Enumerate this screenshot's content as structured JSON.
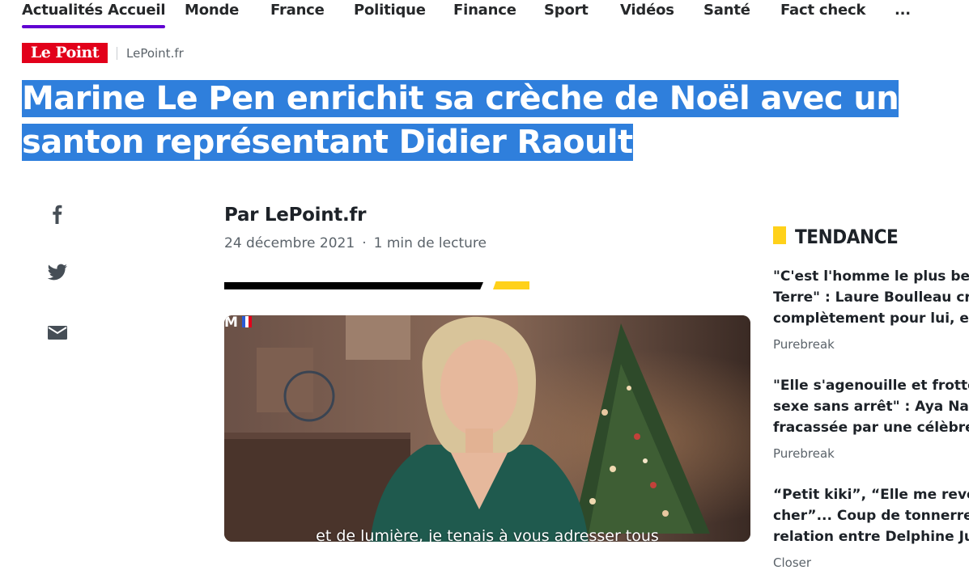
{
  "nav": {
    "items": [
      "Actualités Accueil",
      "Monde",
      "France",
      "Politique",
      "Finance",
      "Sport",
      "Vidéos",
      "Santé",
      "Fact check",
      "..."
    ],
    "active_index": 0,
    "accent_color": "#6001d2"
  },
  "source": {
    "logo_text": "Le Point",
    "name": "LePoint.fr",
    "logo_color": "#e2001a"
  },
  "article": {
    "headline": "Marine Le Pen enrichit sa crèche de Noël avec un santon représentant Didier Raoult",
    "headline_selected": true,
    "selection_color": "#2f7fdc",
    "byline": "Par LePoint.fr",
    "date": "24 décembre 2021",
    "separator": "·",
    "read_time": "1 min de lecture",
    "video": {
      "subtitle": "et de lumière, je tenais à vous adresser tous",
      "logo_icon": "m6-logo-icon"
    }
  },
  "share": [
    {
      "icon": "facebook-icon"
    },
    {
      "icon": "twitter-icon"
    },
    {
      "icon": "mail-icon"
    }
  ],
  "trending": {
    "title": "TENDANCE",
    "accent_color": "#ffd11a",
    "items": [
      {
        "lines": [
          "\"C'est l'homme le plus beau",
          "Terre\" : Laure Boulleau crac",
          "complètement pour lui, et v"
        ],
        "source": "Purebreak"
      },
      {
        "lines": [
          "\"Elle s'agenouille et frotte s",
          "sexe sans arrêt\" : Aya Naka",
          "fracassée par une célèbre..."
        ],
        "source": "Purebreak"
      },
      {
        "lines": [
          "“Petit kiki”, “Elle me revena",
          "cher”... Coup de tonnerre !",
          "relation entre Delphine Jub"
        ],
        "source": "Closer"
      }
    ]
  }
}
